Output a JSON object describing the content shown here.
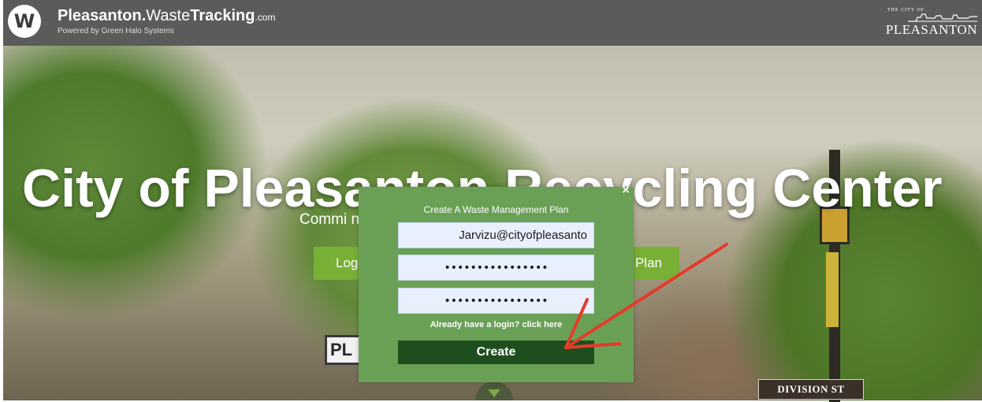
{
  "header": {
    "brand_part1": "Pleasanton.",
    "brand_part2": "Waste",
    "brand_part3": "Tracking",
    "brand_part4": ".com",
    "brand_subtitle": "Powered by Green Halo Systems",
    "logo_glyph": "W",
    "city_logo_small": "THE CITY OF",
    "city_logo_name": "PLEASANTON"
  },
  "hero": {
    "title": "City of Pleasanton Recycling Center",
    "subtitle": "Commi                                            ndards.",
    "button_left_label": "Log",
    "button_right_label": "Plan",
    "sign_text": "PL",
    "street_sign": "DIVISION ST"
  },
  "modal": {
    "title": "Create A Waste Management Plan",
    "email_value": "Jarvizu@cityofpleasanto",
    "password_value": "••••••••••••••••",
    "confirm_password_value": "••••••••••••••••",
    "login_link": "Already have a login? click here",
    "create_label": "Create",
    "close_glyph": "×"
  },
  "colors": {
    "modal_bg": "#6aa056",
    "create_button": "#1e4e1e",
    "hero_button": "#78b036",
    "annotation_arrow": "#e53a2a"
  },
  "icons": {
    "logo": "greenhalo-logo-icon",
    "close": "close-icon",
    "scroll": "chevron-down-icon",
    "annotation": "red-arrow-annotation"
  }
}
